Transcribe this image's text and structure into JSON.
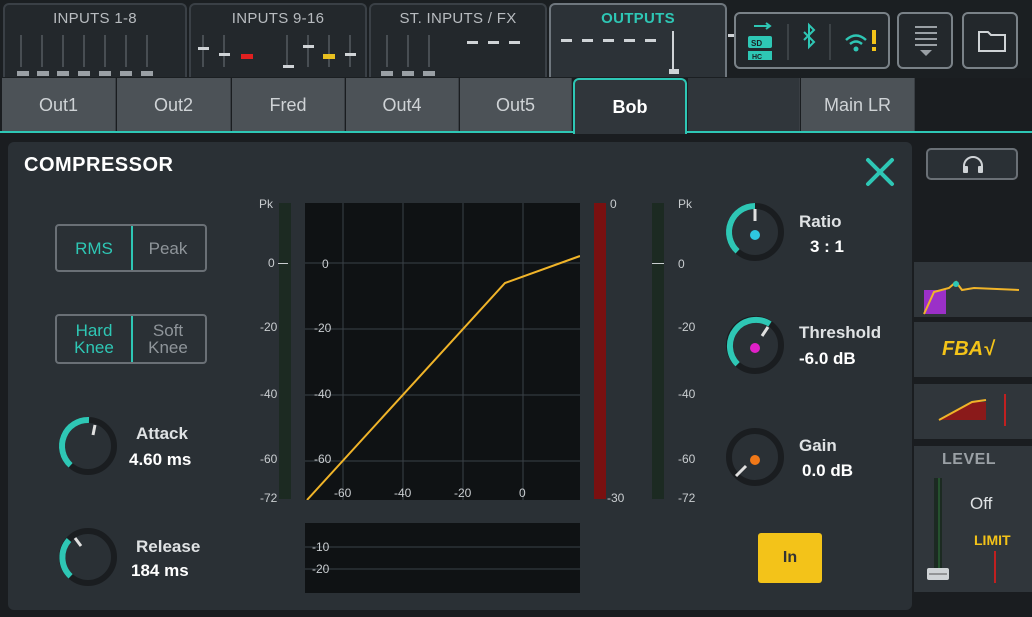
{
  "top_tabs": [
    {
      "label": "INPUTS 1-8"
    },
    {
      "label": "INPUTS 9-16"
    },
    {
      "label": "ST. INPUTS / FX"
    },
    {
      "label": "OUTPUTS"
    }
  ],
  "output_tabs": [
    "Out1",
    "Out2",
    "Fred",
    "Out4",
    "Out5",
    "Bob",
    "Main LR"
  ],
  "active_output_tab": "Bob",
  "compressor": {
    "title": "COMPRESSOR",
    "detector": {
      "options": [
        "RMS",
        "Peak"
      ],
      "selected": "RMS"
    },
    "knee": {
      "options": [
        "Hard\nKnee",
        "Soft\nKnee"
      ],
      "selected": "Hard Knee"
    },
    "attack": {
      "label": "Attack",
      "value": "4.60 ms"
    },
    "release": {
      "label": "Release",
      "value": "184 ms"
    },
    "ratio": {
      "label": "Ratio",
      "value": "3 : 1"
    },
    "threshold": {
      "label": "Threshold",
      "value": "-6.0 dB"
    },
    "gain": {
      "label": "Gain",
      "value": "0.0 dB"
    },
    "in_button": "In",
    "graph": {
      "input_meter_labels": [
        "Pk",
        "0",
        "-20",
        "-40",
        "-60",
        "-72"
      ],
      "inner_y_labels": [
        "0",
        "-20",
        "-40",
        "-60"
      ],
      "x_labels": [
        "-60",
        "-40",
        "-20",
        "0"
      ],
      "gr_meter_labels": [
        "0",
        "-30"
      ],
      "output_meter_labels": [
        "Pk",
        "0",
        "-20",
        "-40",
        "-60",
        "-72"
      ],
      "gr_history_labels": [
        "-10",
        "-20"
      ]
    }
  },
  "right_panel": {
    "fba_label": "FBA√",
    "level_label": "LEVEL",
    "level_value": "Off",
    "limit_label": "LIMIT"
  },
  "colors": {
    "accent": "#2ec7b5",
    "curve": "#f0b429",
    "in_button": "#f3c319",
    "ratio_dot": "#2ec7e0",
    "threshold_dot": "#e020c8",
    "gain_dot": "#f07818"
  }
}
